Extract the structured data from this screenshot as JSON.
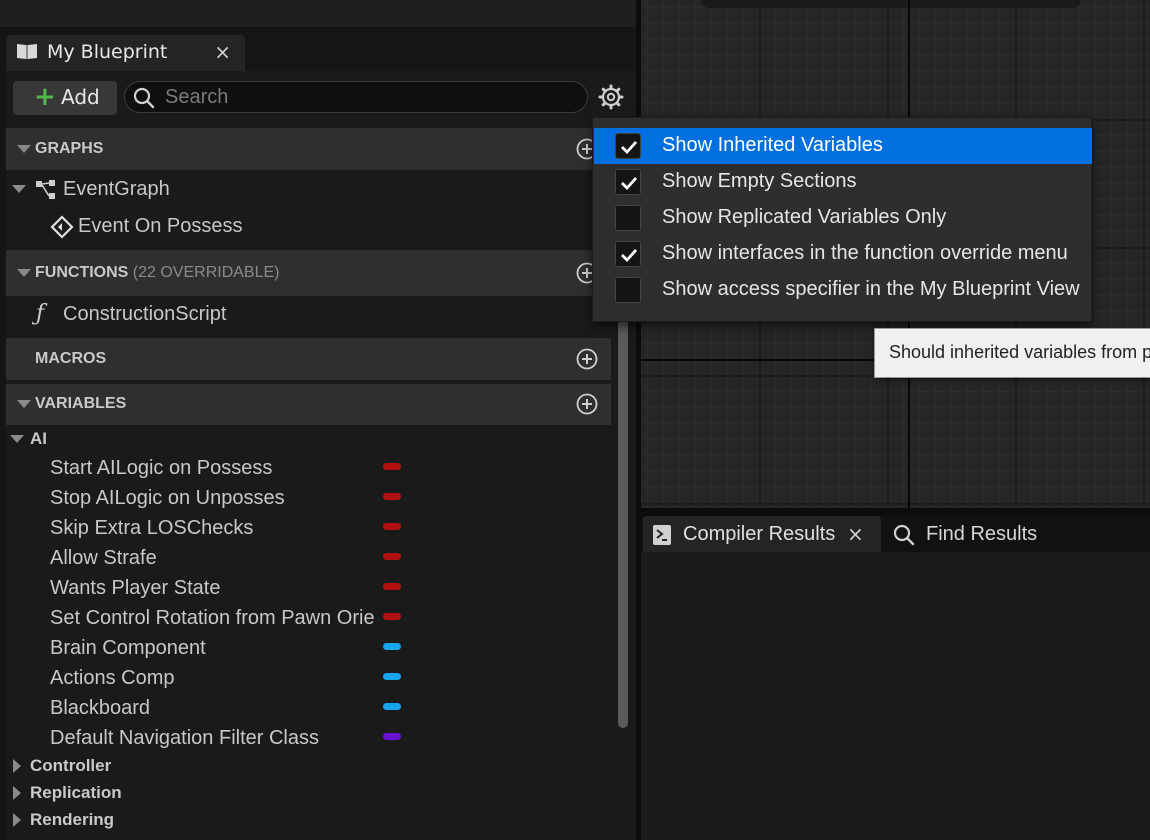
{
  "panel": {
    "tab_title": "My Blueprint",
    "tab_close": "×",
    "add_label": "Add",
    "search_placeholder": "Search"
  },
  "sections": {
    "graphs": {
      "title": "GRAPHS"
    },
    "functions": {
      "title": "FUNCTIONS",
      "subtitle": "(22 OVERRIDABLE)"
    },
    "macros": {
      "title": "MACROS"
    },
    "variables": {
      "title": "VARIABLES"
    }
  },
  "graphs": {
    "event_graph": "EventGraph",
    "event_on_possess": "Event On Possess"
  },
  "functions": {
    "construction_script": "ConstructionScript"
  },
  "variables": {
    "ai_category": "AI",
    "items": [
      {
        "name": "Start AILogic on Possess",
        "color": "#b01010"
      },
      {
        "name": "Stop AILogic on Unposses",
        "color": "#b01010"
      },
      {
        "name": "Skip Extra LOSChecks",
        "color": "#b01010"
      },
      {
        "name": "Allow Strafe",
        "color": "#b01010"
      },
      {
        "name": "Wants Player State",
        "color": "#b01010"
      },
      {
        "name": "Set Control Rotation from Pawn Orientation",
        "color": "#b01010"
      },
      {
        "name": "Brain Component",
        "color": "#17a6ee"
      },
      {
        "name": "Actions Comp",
        "color": "#17a6ee"
      },
      {
        "name": "Blackboard",
        "color": "#17a6ee"
      },
      {
        "name": "Default Navigation Filter Class",
        "color": "#6a10d0"
      }
    ],
    "categories": [
      "Controller",
      "Replication",
      "Rendering"
    ]
  },
  "menu": {
    "items": [
      {
        "label": "Show Inherited Variables",
        "checked": true,
        "highlighted": true
      },
      {
        "label": "Show Empty Sections",
        "checked": true,
        "highlighted": false
      },
      {
        "label": "Show Replicated Variables Only",
        "checked": false,
        "highlighted": false
      },
      {
        "label": "Show interfaces in the function override menu",
        "checked": true,
        "highlighted": false
      },
      {
        "label": "Show access specifier in the My Blueprint View",
        "checked": false,
        "highlighted": false
      }
    ]
  },
  "tooltip": {
    "text": "Should inherited variables from parent"
  },
  "bottom": {
    "compiler_results": "Compiler Results",
    "close": "×",
    "find_results": "Find Results"
  },
  "colors": {
    "accent": "#0070e0",
    "add_plus": "#4fb84a"
  }
}
